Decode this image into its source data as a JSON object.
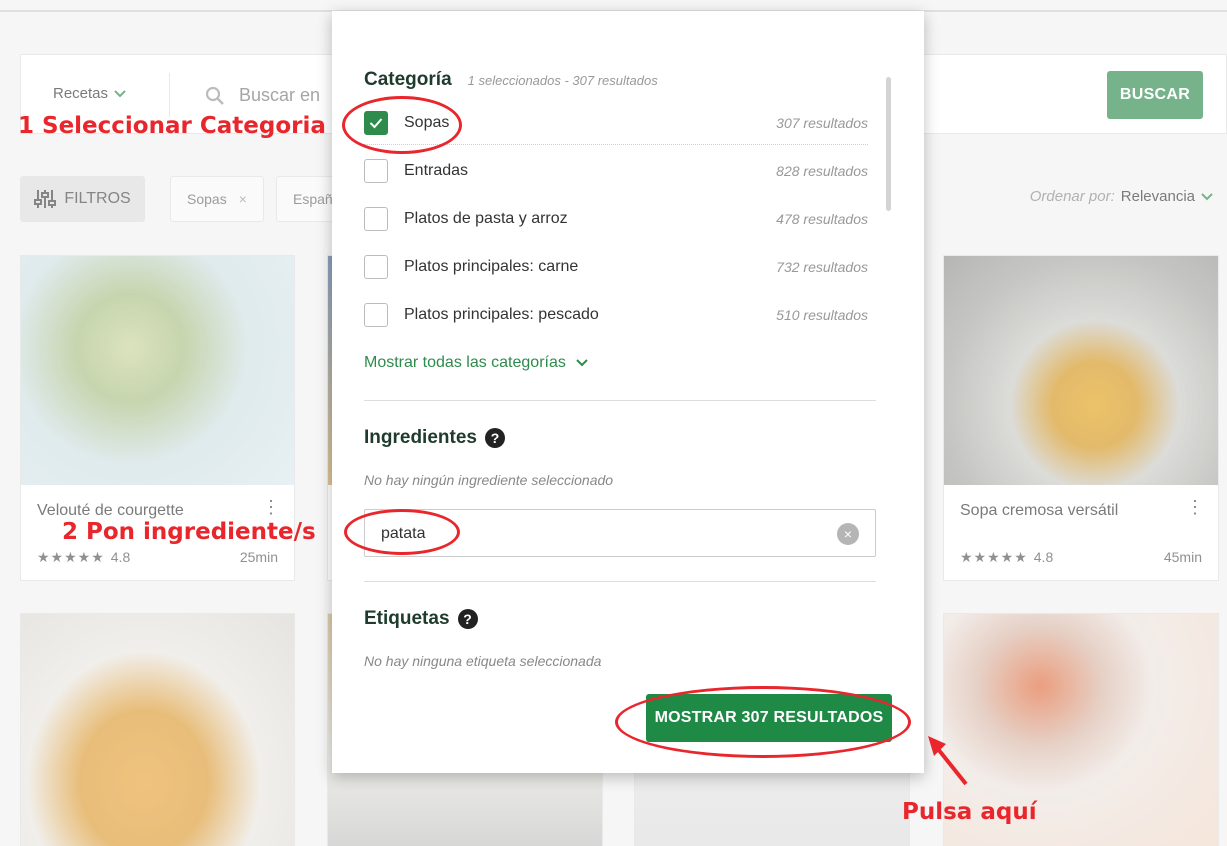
{
  "background": {
    "search": {
      "dropdown_label": "Recetas",
      "placeholder": "Buscar en",
      "button_label": "BUSCAR"
    },
    "filters": {
      "button_label": "FILTROS",
      "chips": [
        {
          "label": "Sopas",
          "remove": "×"
        },
        {
          "label": "Españ",
          "remove": ""
        }
      ],
      "sort_label": "Ordenar por:",
      "sort_value": "Relevancia"
    },
    "cards": [
      {
        "title": "Velouté de courgette",
        "rating": "4.8",
        "stars": "★★★★★",
        "time": "25min"
      },
      {
        "title": "Sopa cremosa versátil",
        "rating": "4.8",
        "stars": "★★★★★",
        "time": "45min"
      }
    ]
  },
  "modal": {
    "category": {
      "title": "Categoría",
      "meta": "1 seleccionados - 307 resultados",
      "items": [
        {
          "label": "Sopas",
          "count": "307 resultados",
          "checked": true
        },
        {
          "label": "Entradas",
          "count": "828 resultados",
          "checked": false
        },
        {
          "label": "Platos de pasta y arroz",
          "count": "478 resultados",
          "checked": false
        },
        {
          "label": "Platos principales: carne",
          "count": "732 resultados",
          "checked": false
        },
        {
          "label": "Platos principales: pescado",
          "count": "510 resultados",
          "checked": false
        }
      ],
      "show_all": "Mostrar todas las categorías"
    },
    "ingredients": {
      "title": "Ingredientes",
      "help": "?",
      "empty_note": "No hay ningún ingrediente seleccionado",
      "input_value": "patata",
      "clear": "×"
    },
    "tags": {
      "title": "Etiquetas",
      "help": "?",
      "empty_note": "No hay ninguna etiqueta seleccionada"
    },
    "show_results_label": "MOSTRAR 307 RESULTADOS"
  },
  "annotations": {
    "step1": "1 Seleccionar Categoria",
    "step2": "2 Pon ingrediente/s",
    "step3": "Pulsa aquí"
  },
  "colors": {
    "accent_green": "#2e8b4c",
    "annotation_red": "#e8262b"
  }
}
